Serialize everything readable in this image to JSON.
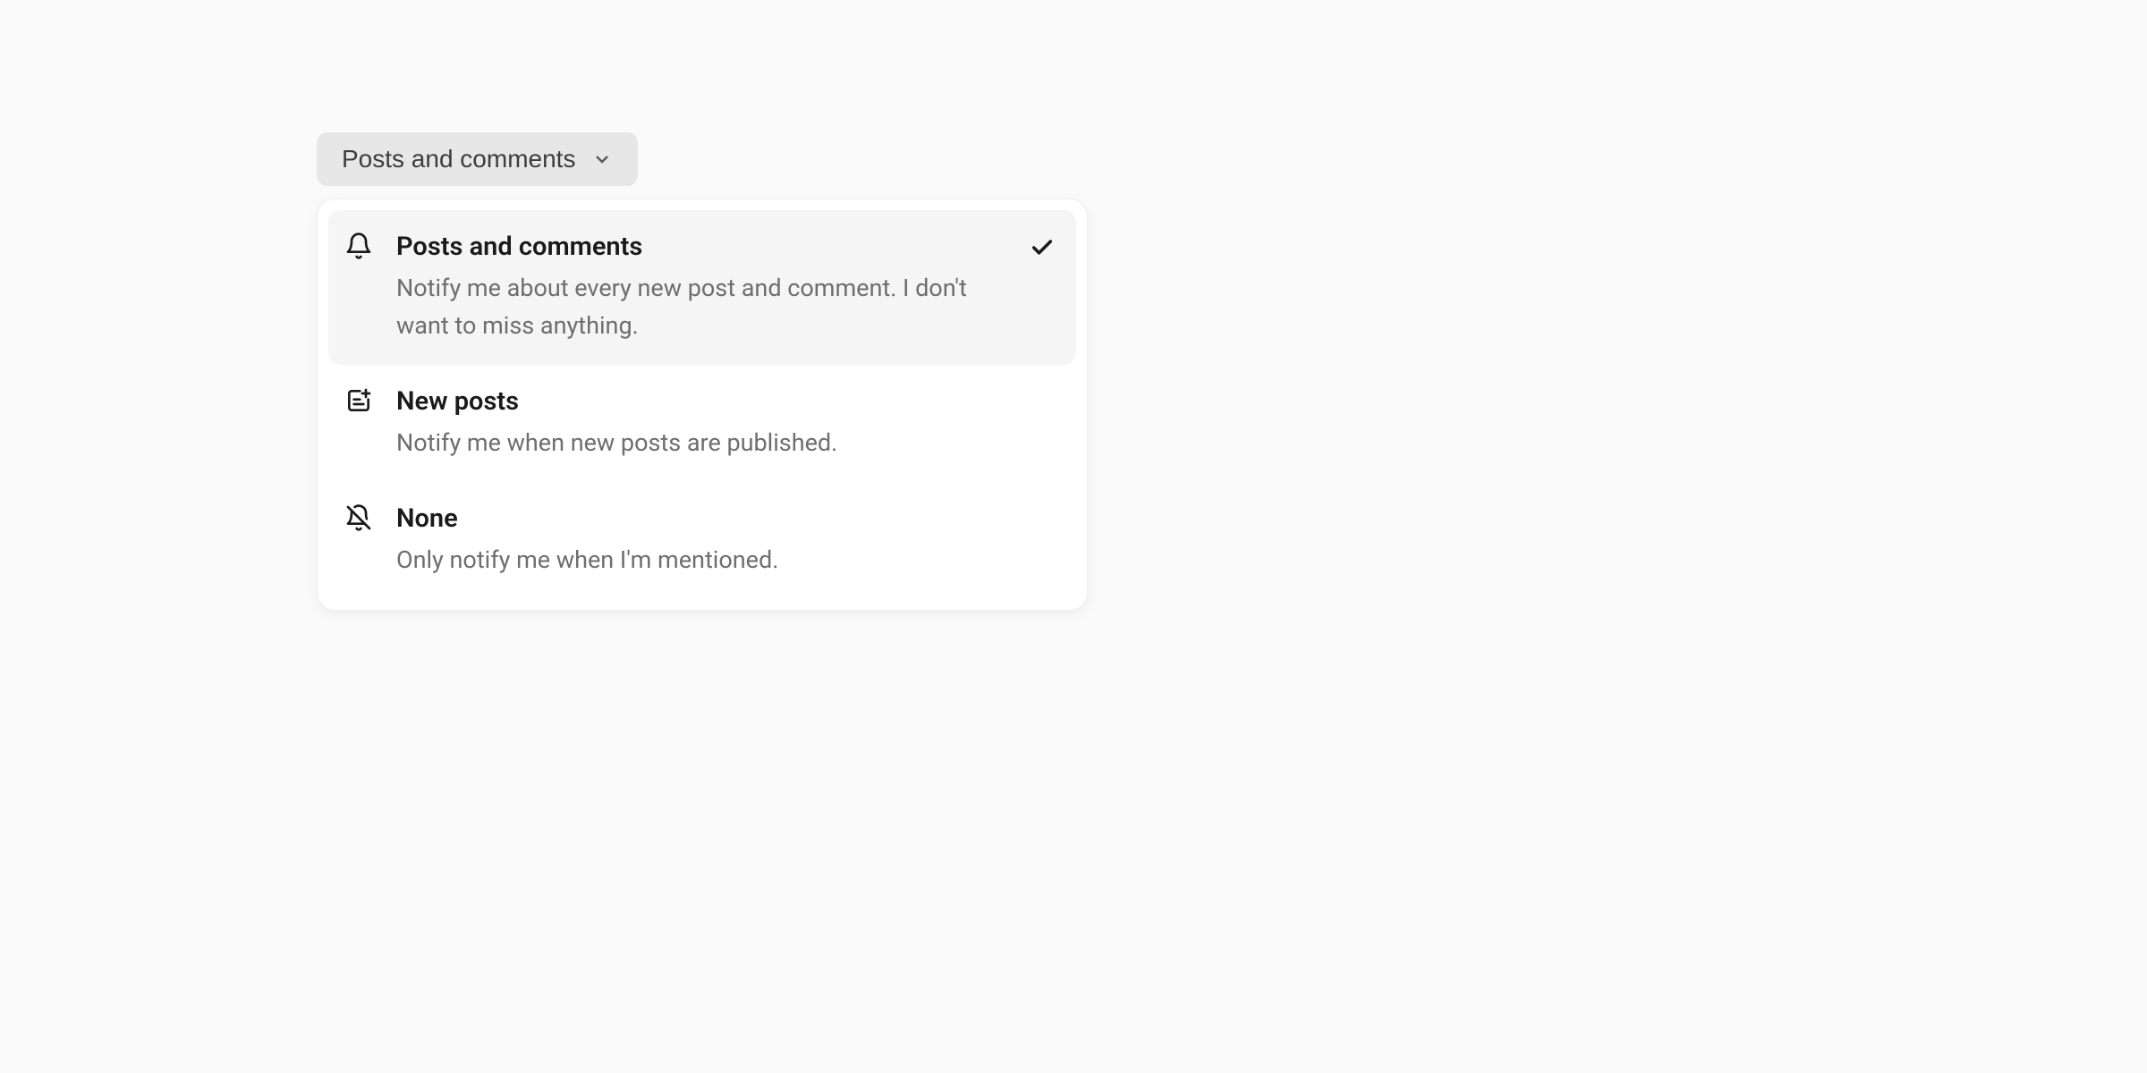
{
  "trigger": {
    "label": "Posts and comments"
  },
  "options": [
    {
      "title": "Posts and comments",
      "description": "Notify me about every new post and comment. I don't want to miss anything.",
      "selected": true
    },
    {
      "title": "New posts",
      "description": "Notify me when new posts are published.",
      "selected": false
    },
    {
      "title": "None",
      "description": "Only notify me when I'm mentioned.",
      "selected": false
    }
  ]
}
